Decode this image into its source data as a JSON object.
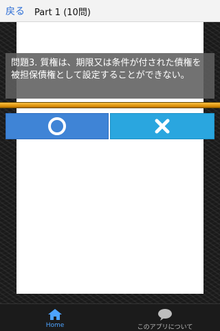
{
  "header": {
    "back_label": "戻る",
    "title": "Part 1 (10問)"
  },
  "question": {
    "text": "問題3. 質権は、期限又は条件が付された債権を被担保債権として設定することができない。"
  },
  "progress": {
    "value_fraction": 1.0
  },
  "answers": {
    "true_icon": "circle-icon",
    "false_icon": "cross-icon"
  },
  "bottom_nav": {
    "home_label": "Home",
    "home_icon": "home-icon",
    "about_label": "このアプリについて",
    "about_icon": "speech-bubble-icon"
  },
  "colors": {
    "true_button": "#3f84d6",
    "false_button": "#2aa6df",
    "progress": "#e39a10",
    "active_nav": "#4da3ff"
  }
}
